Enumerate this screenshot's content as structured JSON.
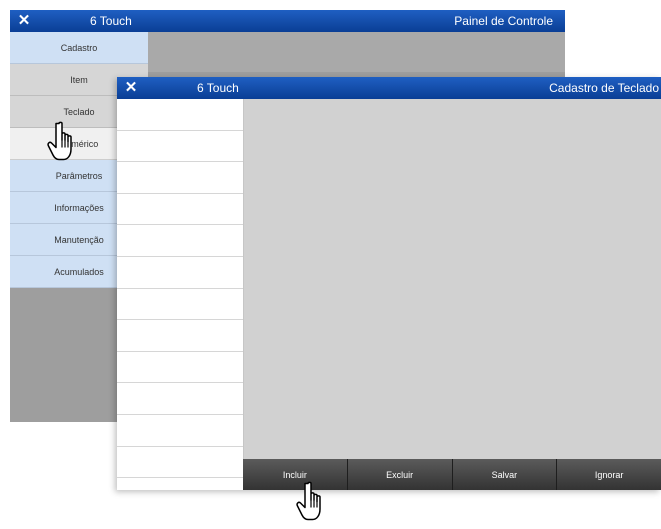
{
  "back_window": {
    "app_name": "6 Touch",
    "title": "Painel de Controle",
    "menu": [
      {
        "label": "Cadastro",
        "style": "blue"
      },
      {
        "label": "Item",
        "style": "gray"
      },
      {
        "label": "Teclado",
        "style": "gray"
      },
      {
        "label": "Numérico",
        "style": "white"
      },
      {
        "label": "Parâmetros",
        "style": "blue"
      },
      {
        "label": "Informações",
        "style": "blue"
      },
      {
        "label": "Manutenção",
        "style": "blue"
      },
      {
        "label": "Acumulados",
        "style": "blue"
      }
    ]
  },
  "front_window": {
    "app_name": "6 Touch",
    "title": "Cadastro de Teclado",
    "buttons": {
      "incluir": "Incluir",
      "excluir": "Excluir",
      "salvar": "Salvar",
      "ignorar": "Ignorar"
    }
  },
  "colors": {
    "titlebar": "#1a56b5",
    "menu_blue": "#cfe0f4",
    "menu_gray": "#d6d6d6",
    "button_dark": "#444444"
  },
  "icons": {
    "close": "close-icon",
    "cursor": "hand-pointer-icon"
  }
}
